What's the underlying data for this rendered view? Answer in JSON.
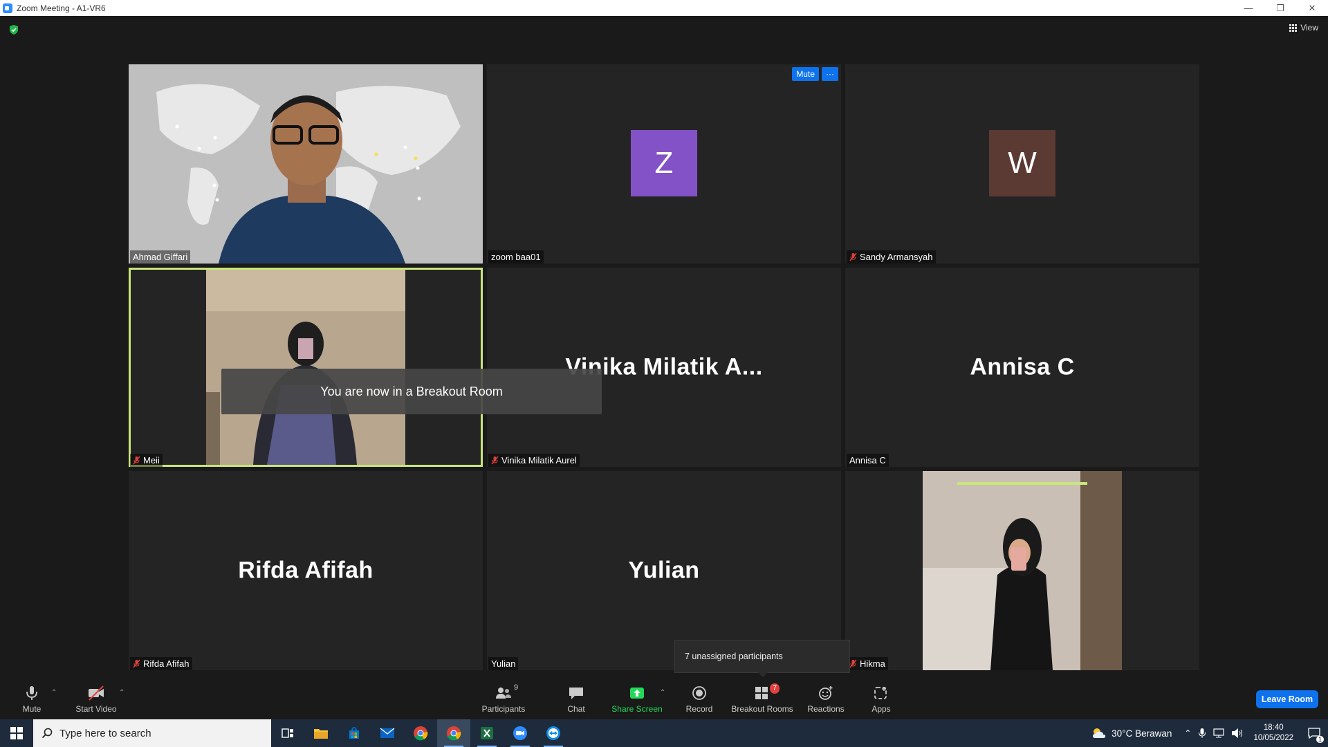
{
  "window": {
    "title": "Zoom Meeting - A1-VR6"
  },
  "header": {
    "view_label": "View"
  },
  "tiles": [
    {
      "name": "Ahmad Giffari",
      "muted": false,
      "type": "video"
    },
    {
      "name": "zoom baa01",
      "muted": false,
      "type": "avatar",
      "avatar_letter": "Z",
      "avatar_color": "#8352c6",
      "buttons": [
        "Mute",
        "···"
      ]
    },
    {
      "name": "Sandy Armansyah",
      "muted": true,
      "type": "avatar",
      "avatar_letter": "W",
      "avatar_color": "#5b3a33"
    },
    {
      "name": "Meii",
      "muted": true,
      "type": "video",
      "active_speaker": true
    },
    {
      "name": "Vinika Milatik Aurel",
      "muted": true,
      "type": "name",
      "display_name": "Vinika Milatik A..."
    },
    {
      "name": "Annisa C",
      "muted": false,
      "type": "name",
      "display_name": "Annisa C"
    },
    {
      "name": "Rifda Afifah",
      "muted": true,
      "type": "name",
      "display_name": "Rifda Afifah"
    },
    {
      "name": "Yulian",
      "muted": false,
      "type": "name",
      "display_name": "Yulian"
    },
    {
      "name": "Hikma",
      "muted": true,
      "type": "video"
    }
  ],
  "notification": {
    "text": "You are now in a Breakout Room"
  },
  "popover": {
    "text": "7 unassigned participants"
  },
  "toolbar": {
    "mute": "Mute",
    "start_video": "Start Video",
    "participants": "Participants",
    "participants_count": "9",
    "chat": "Chat",
    "share_screen": "Share Screen",
    "record": "Record",
    "breakout_rooms": "Breakout Rooms",
    "breakout_badge": "7",
    "reactions": "Reactions",
    "apps": "Apps",
    "leave": "Leave Room"
  },
  "taskbar": {
    "search_placeholder": "Type here to search",
    "weather": "30°C  Berawan",
    "time": "18:40",
    "date": "10/05/2022",
    "notification_count": "1"
  },
  "colors": {
    "accent": "#0e72ed",
    "speaker_highlight": "#c8e67a",
    "share_green": "#23d959"
  }
}
